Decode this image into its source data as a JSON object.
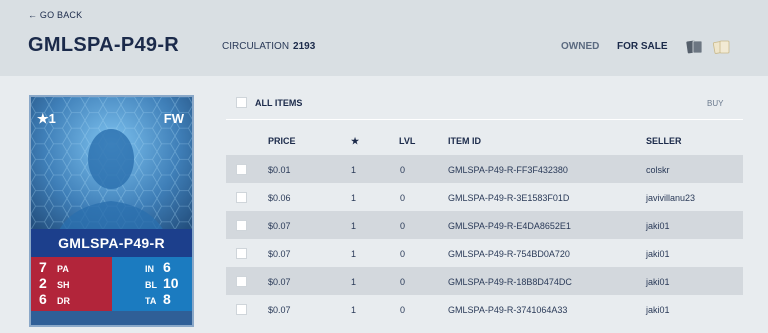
{
  "header": {
    "back_label": "← GO BACK",
    "title": "GMLSPA-P49-R",
    "circulation_label": "CIRCULATION",
    "circulation_value": "2193",
    "owned_label": "OWNED",
    "for_sale_label": "FOR SALE"
  },
  "card": {
    "rating": "★1",
    "position": "FW",
    "name": "GMLSPA-P49-R",
    "stats_left": [
      {
        "value": "7",
        "key": "PA"
      },
      {
        "value": "2",
        "key": "SH"
      },
      {
        "value": "6",
        "key": "DR"
      }
    ],
    "stats_right": [
      {
        "key": "IN",
        "value": "6"
      },
      {
        "key": "BL",
        "value": "10"
      },
      {
        "key": "TA",
        "value": "8"
      }
    ]
  },
  "table": {
    "all_items_label": "ALL ITEMS",
    "buy_label": "BUY",
    "headers": {
      "price": "PRICE",
      "star": "★",
      "lvl": "LVL",
      "item_id": "ITEM ID",
      "seller": "SELLER"
    },
    "rows": [
      {
        "price": "$0.01",
        "star": "1",
        "lvl": "0",
        "item_id": "GMLSPA-P49-R-FF3F432380",
        "seller": "colskr"
      },
      {
        "price": "$0.06",
        "star": "1",
        "lvl": "0",
        "item_id": "GMLSPA-P49-R-3E1583F01D",
        "seller": "javivillanu23"
      },
      {
        "price": "$0.07",
        "star": "1",
        "lvl": "0",
        "item_id": "GMLSPA-P49-R-E4DA8652E1",
        "seller": "jaki01"
      },
      {
        "price": "$0.07",
        "star": "1",
        "lvl": "0",
        "item_id": "GMLSPA-P49-R-754BD0A720",
        "seller": "jaki01"
      },
      {
        "price": "$0.07",
        "star": "1",
        "lvl": "0",
        "item_id": "GMLSPA-P49-R-18B8D474DC",
        "seller": "jaki01"
      },
      {
        "price": "$0.07",
        "star": "1",
        "lvl": "0",
        "item_id": "GMLSPA-P49-R-3741064A33",
        "seller": "jaki01"
      }
    ]
  },
  "colors": {
    "header_bg": "#d9dfe3",
    "row_dark": "#d3d8dd",
    "text": "#1b2a4a",
    "card_red": "#b2253a",
    "card_blue": "#1b7bc0"
  },
  "icons": [
    "card-stack-icon",
    "card-pack-icon",
    "player-silhouette-icon"
  ]
}
